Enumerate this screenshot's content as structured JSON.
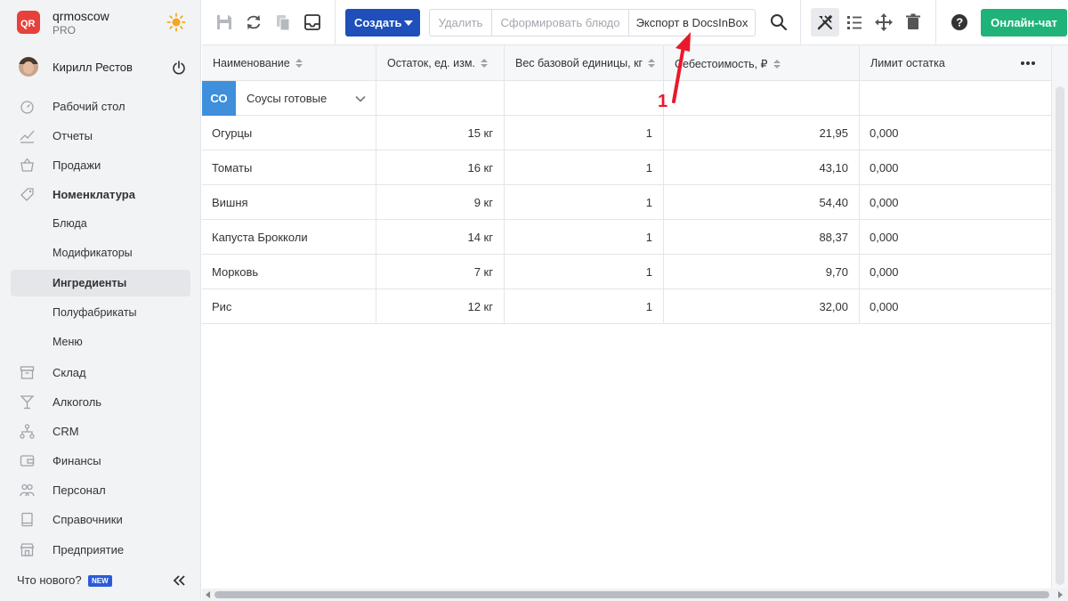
{
  "brand": {
    "name": "qrmoscow",
    "plan": "PRO",
    "logo_text": "QR"
  },
  "user": {
    "name": "Кирилл Рестов"
  },
  "sidebar": {
    "items": [
      {
        "label": "Рабочий стол",
        "icon": "dashboard-icon"
      },
      {
        "label": "Отчеты",
        "icon": "chart-icon"
      },
      {
        "label": "Продажи",
        "icon": "basket-icon"
      },
      {
        "label": "Номенклатура",
        "icon": "tag-icon"
      },
      {
        "label": "Блюда"
      },
      {
        "label": "Модификаторы"
      },
      {
        "label": "Ингредиенты"
      },
      {
        "label": "Полуфабрикаты"
      },
      {
        "label": "Меню"
      },
      {
        "label": "Склад",
        "icon": "box-icon"
      },
      {
        "label": "Алкоголь",
        "icon": "glass-icon"
      },
      {
        "label": "CRM",
        "icon": "hierarchy-icon"
      },
      {
        "label": "Финансы",
        "icon": "wallet-icon"
      },
      {
        "label": "Персонал",
        "icon": "people-icon"
      },
      {
        "label": "Справочники",
        "icon": "book-icon"
      },
      {
        "label": "Предприятие",
        "icon": "store-icon"
      }
    ],
    "active": "Ингредиенты",
    "whats_new": "Что нового?",
    "new_badge": "NEW"
  },
  "toolbar": {
    "create_label": "Создать",
    "delete_label": "Удалить",
    "form_dish_label": "Сформировать блюдо",
    "export_label": "Экспорт в DocsInBox",
    "chat_label": "Онлайн-чат",
    "colors": {
      "create": "#1e4fba",
      "chat": "#1fb37a"
    }
  },
  "table": {
    "columns": [
      "Наименование",
      "Остаток, ед. изм.",
      "Вес базовой единицы, кг",
      "Себестоимость, ₽",
      "Лимит остатка"
    ],
    "group": {
      "badge": "СО",
      "name": "Соусы готовые",
      "badge_color": "#3f8fdd"
    },
    "rows": [
      {
        "name": "Огурцы",
        "stock": "15 кг",
        "weight": "1",
        "cost": "21,95",
        "limit": "0,000"
      },
      {
        "name": "Томаты",
        "stock": "16 кг",
        "weight": "1",
        "cost": "43,10",
        "limit": "0,000"
      },
      {
        "name": "Вишня",
        "stock": "9 кг",
        "weight": "1",
        "cost": "54,40",
        "limit": "0,000"
      },
      {
        "name": "Капуста Брокколи",
        "stock": "14 кг",
        "weight": "1",
        "cost": "88,37",
        "limit": "0,000"
      },
      {
        "name": "Морковь",
        "stock": "7 кг",
        "weight": "1",
        "cost": "9,70",
        "limit": "0,000"
      },
      {
        "name": "Рис",
        "stock": "12 кг",
        "weight": "1",
        "cost": "32,00",
        "limit": "0,000"
      }
    ]
  },
  "annotation": {
    "number": "1",
    "color": "#e8192c"
  }
}
